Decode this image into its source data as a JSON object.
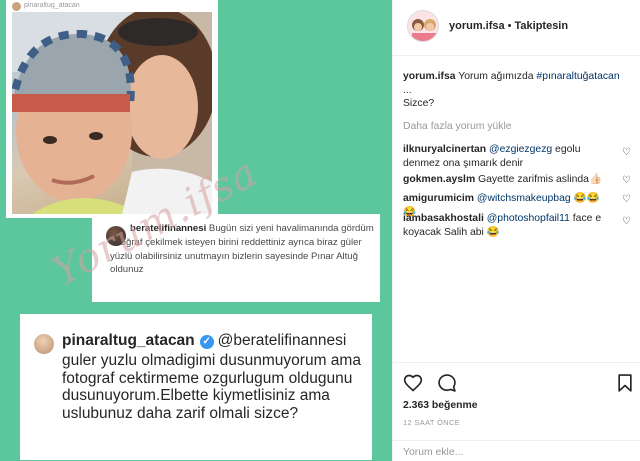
{
  "post_image": {
    "photo_username": "pinaraltug_atacan",
    "comment1": {
      "username": "beratelifinannesi",
      "text": " Bugün sizi yeni havalimanında gördüm fotoğraf çekilmek isteyen birini reddettiniz ayrıca biraz güler yüzlü olabilirsiniz unutmayın bizlerin sayesinde Pınar Altuğ oldunuz"
    },
    "comment2": {
      "username": "pinaraltug_atacan",
      "mention": "@beratelifinannesi",
      "text": "guler yuzlu olmadigimi dusunmuyorum ama fotograf cektirmeme ozgurlugum oldugunu dusunuyorum.Elbette kiymetlisiniz ama uslubunuz daha zarif olmali sizce?"
    },
    "watermark": "Yorum.ifsa"
  },
  "header": {
    "username": "yorum.ifsa",
    "separator": "•",
    "follow_status": "Takiptesin"
  },
  "caption": {
    "username": "yorum.ifsa",
    "text": " Yorum ağımızda ",
    "hashtag": "#pınaraltuğatacan",
    "ellipsis": "...",
    "question": "Sizce?"
  },
  "load_more": "Daha fazla yorum yükle",
  "comments": [
    {
      "username": "ilknuryalcinertan",
      "mention": "@ezgiezgezg",
      "text": " egolu denmez ona şımarık denir"
    },
    {
      "username": "gokmen.ayslm",
      "mention": "",
      "text": " Gayette zarifmis aslinda👍🏻"
    },
    {
      "username": "amigurumicim",
      "mention": "@witchsmakeupbag",
      "text": " 😂😂😂"
    },
    {
      "username": "iambasakhostali",
      "mention": "@photoshopfail11",
      "text": " face e koyacak Salih abi 😂"
    }
  ],
  "likes": "2.363 beğenme",
  "time": "12 SAAT ÖNCE",
  "add_comment_placeholder": "Yorum ekle...",
  "icons": [
    "heart-icon",
    "comment-icon",
    "bookmark-icon"
  ]
}
